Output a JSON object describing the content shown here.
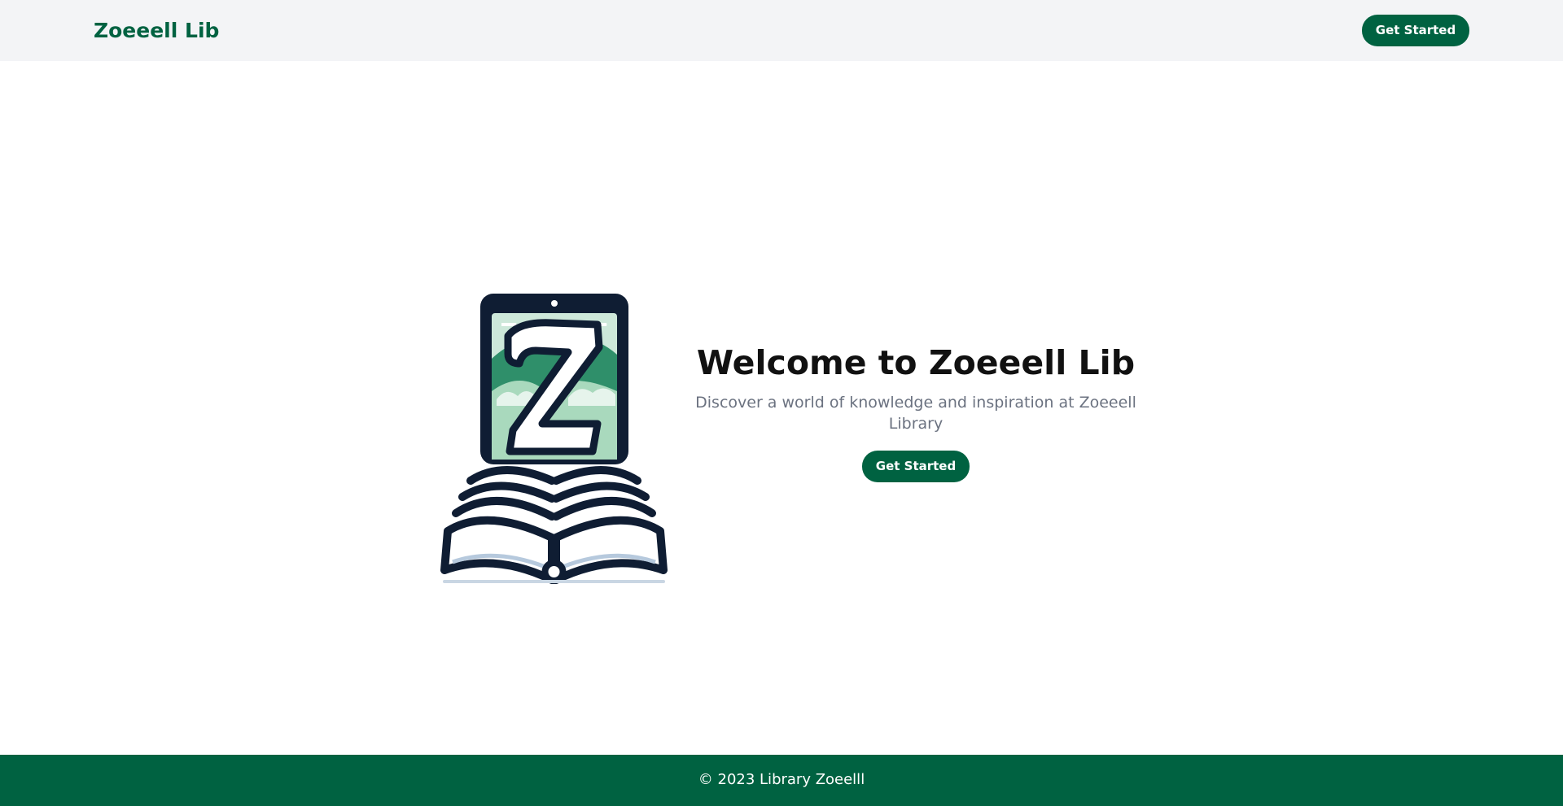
{
  "navbar": {
    "brand": "Zoeeell Lib",
    "cta_label": "Get Started"
  },
  "hero": {
    "logo_icon": "book-tablet-z-logo-icon",
    "title": "Welcome to Zoeeell Lib",
    "subtitle": "Discover a world of knowledge and inspiration at Zoeeell Library",
    "cta_label": "Get Started"
  },
  "footer": {
    "copyright": "© 2023 Library Zoeelll"
  },
  "colors": {
    "brand": "#006241",
    "nav_bg": "#f3f4f6",
    "title": "#111111",
    "subtitle": "#6b7280"
  }
}
